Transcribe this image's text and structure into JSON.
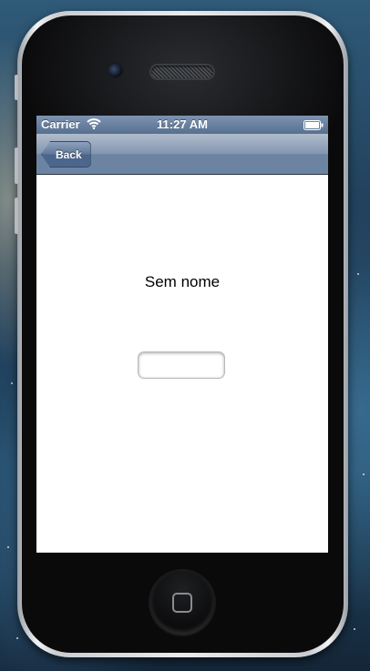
{
  "status_bar": {
    "carrier": "Carrier",
    "time": "11:27 AM",
    "wifi_icon": "wifi-icon",
    "battery_icon": "battery-icon"
  },
  "nav_bar": {
    "back_label": "Back",
    "back_icon": "chevron-left-shape"
  },
  "content": {
    "title": "Sem nome",
    "text_field_value": "",
    "text_field_placeholder": ""
  },
  "colors": {
    "navbar": "#6d83a2",
    "statusbar": "#56708f",
    "screen_background": "#ffffff"
  }
}
